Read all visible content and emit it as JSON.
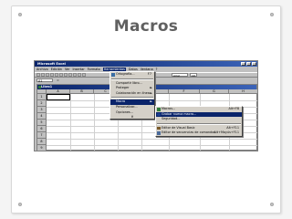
{
  "slide": {
    "title": "Macros"
  },
  "window": {
    "title": "Microsoft Excel"
  },
  "menubar": [
    "Archivo",
    "Edición",
    "Ver",
    "Insertar",
    "Formato",
    "Herramientas",
    "Datos",
    "Ventana",
    "?"
  ],
  "toolbar": {
    "font": "Arial",
    "size": "10"
  },
  "formula": {
    "cell": "A1",
    "fx": "="
  },
  "workbook": {
    "title": "Libro1",
    "columns": [
      "A",
      "B",
      "C",
      "D",
      "E",
      "F",
      "G",
      "H"
    ],
    "rows": [
      "1",
      "2",
      "3",
      "4",
      "5",
      "6",
      "7",
      "8",
      "9"
    ]
  },
  "tools_menu": {
    "items": [
      {
        "label": "Ortografía...",
        "shortcut": "F7"
      },
      {
        "label": "Compartir libro..."
      },
      {
        "label": "Proteger",
        "arrow": "►"
      },
      {
        "label": "Colaboración en línea",
        "arrow": "►"
      },
      {
        "label": "Macro",
        "arrow": "►"
      },
      {
        "label": "Personalizar..."
      },
      {
        "label": "Opciones..."
      }
    ],
    "more": "¥"
  },
  "macro_submenu": {
    "items": [
      {
        "label": "Macros...",
        "shortcut": "Alt+F8"
      },
      {
        "label": "Grabar nueva macro..."
      },
      {
        "label": "Seguridad..."
      },
      {
        "label": "Editor de Visual Basic",
        "shortcut": "Alt+F11"
      },
      {
        "label": "Editor de secuencias de comandos",
        "shortcut": "Alt+Mayús+F11"
      }
    ]
  },
  "colors": {
    "titlebar": "#0a246a",
    "highlight": "#0a246a",
    "menu_bg": "#d4d0c8",
    "slide_title": "#606060"
  }
}
